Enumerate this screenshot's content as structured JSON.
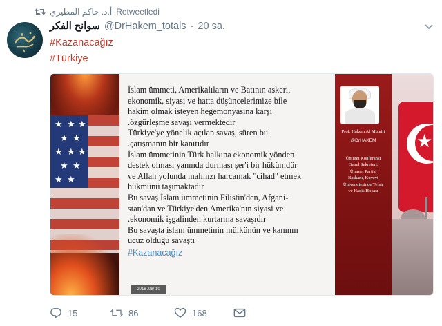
{
  "retweet": {
    "by": "أ.د. حاكم المطيري",
    "label": "Retweetledi"
  },
  "tweet": {
    "display_name": "سوانح الفكر",
    "handle": "@DrHakem_totals",
    "separator": "·",
    "time": "20 sa.",
    "hashtags": [
      "#Kazanacağız",
      "#Türkiye"
    ]
  },
  "media": {
    "lines": [
      "İslam ümmeti, Amerikalıların ve Batının askeri,",
      "ekonomik, siyasi ve hatta düşüncelerimize bile",
      "hakim olmak isteyen hegemonyasına karşı",
      ".özgürleşme savaşı vermektedir",
      "Türkiye'ye yönelik açılan savaş, süren bu",
      ".çatışmanın bir kanıtıdır",
      "İslam ümmetinin Türk halkına ekonomik yönden",
      "destek olması yanında durması şer'i bir hükümdür",
      "ve Allah yolunda malınızı harcamak \"cihad\" etmek",
      "hükmünü taşımaktadır",
      "Bu savaş İslam ümmetinin Filistin'den, Afgani-",
      "stan'dan ve Türkiye'den  Amerika'nın siyasi ve",
      ".ekonomik işgalinden kurtarma savaşıdır",
      "Bu savaşta islam ümmetinin mülkünün ve kanının",
      "ucuz olduğu savaştı"
    ],
    "hashtag": "#Kazanacağız",
    "date": "2018 /08/ 10",
    "profile": {
      "name": "Prof. Hakem Al Mutairi",
      "twitter": "@DrHAKEM",
      "bio": [
        "Ümmet Konferansı",
        "Genel Sekreteri,",
        "Ümmet Partisi",
        "Başkanı, Kuveyt",
        "Üniversitesinde Tefsir",
        "ve Hadis Hocası"
      ]
    }
  },
  "actions": {
    "reply_count": "15",
    "retweet_count": "86",
    "like_count": "168"
  },
  "icons": {
    "retweet": "retweet-icon",
    "reply": "reply-icon",
    "like": "heart-icon",
    "dm": "envelope-icon",
    "menu": "chevron-down-icon"
  },
  "colors": {
    "hashtag": "#c0392b",
    "muted": "#657786",
    "retweet_green": "#17bf63"
  }
}
